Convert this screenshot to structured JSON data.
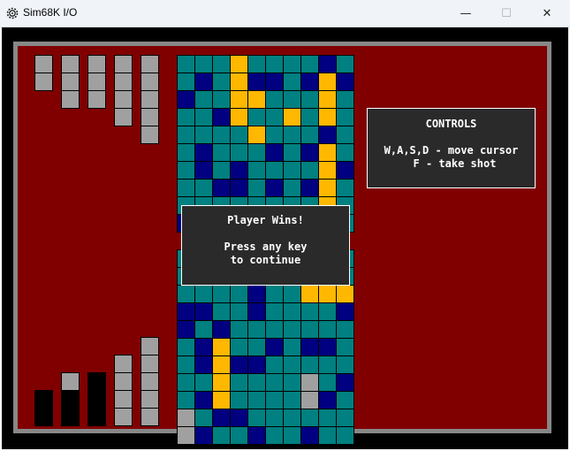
{
  "window": {
    "title": "Sim68K I/O",
    "minimize_glyph": "—",
    "maximize_glyph": "☐",
    "close_glyph": "✕"
  },
  "controls_panel": {
    "title": "CONTROLS",
    "line1": "W,A,S,D - move cursor",
    "line2": "F - take shot"
  },
  "message": {
    "title": "Player Wins!",
    "line1": "Press any key",
    "line2": "to continue"
  },
  "colors": {
    "window_bg": "#000000",
    "frame": "#888888",
    "play_area": "#800000",
    "water": "#008080",
    "miss": "#000080",
    "hit": "#FFB800",
    "ship": "#A0A0A0",
    "sunk": "#000000",
    "panel_bg": "#2a2a2a"
  },
  "legend": {
    "T": "teal water",
    "N": "navy miss",
    "Y": "yellow hit",
    "G": "gray ship",
    "B": "black sunk"
  },
  "top_board": [
    "TTTYTTTTNT",
    "TNTYNNTNYN",
    "NTTYYTTTYT",
    "TTNYTTYTYT",
    "TTTTYTTTNT",
    "TNTTTNTNYT",
    "TNTNTTTTYN",
    "TTNNTNTNYT",
    "TTTTTTTTYT",
    "NTTTTTTTNT"
  ],
  "bottom_board": [
    "TTTTTNTTNT",
    "TTTTTTTTTT",
    "TTTTNTTYYY",
    "NNTTNTTTTN",
    "NTNTTTTTTT",
    "TNYTTNTNNT",
    "TNYNNTTTTT",
    "TTYTTTTGTN",
    "TNYTTTTGNT",
    "GTNNTTTTTT",
    "GNTTNTTNTT"
  ],
  "top_fleet": [
    {
      "length": 2,
      "cells": "GG"
    },
    {
      "length": 3,
      "cells": "GGG"
    },
    {
      "length": 3,
      "cells": "GGG"
    },
    {
      "length": 4,
      "cells": "GGGG"
    },
    {
      "length": 5,
      "cells": "GGGGG"
    }
  ],
  "bottom_fleet": [
    {
      "length": 2,
      "cells": "BB"
    },
    {
      "length": 3,
      "cells": "GBB"
    },
    {
      "length": 3,
      "cells": "BBB"
    },
    {
      "length": 4,
      "cells": "GGGG"
    },
    {
      "length": 5,
      "cells": "GGGGG"
    }
  ]
}
